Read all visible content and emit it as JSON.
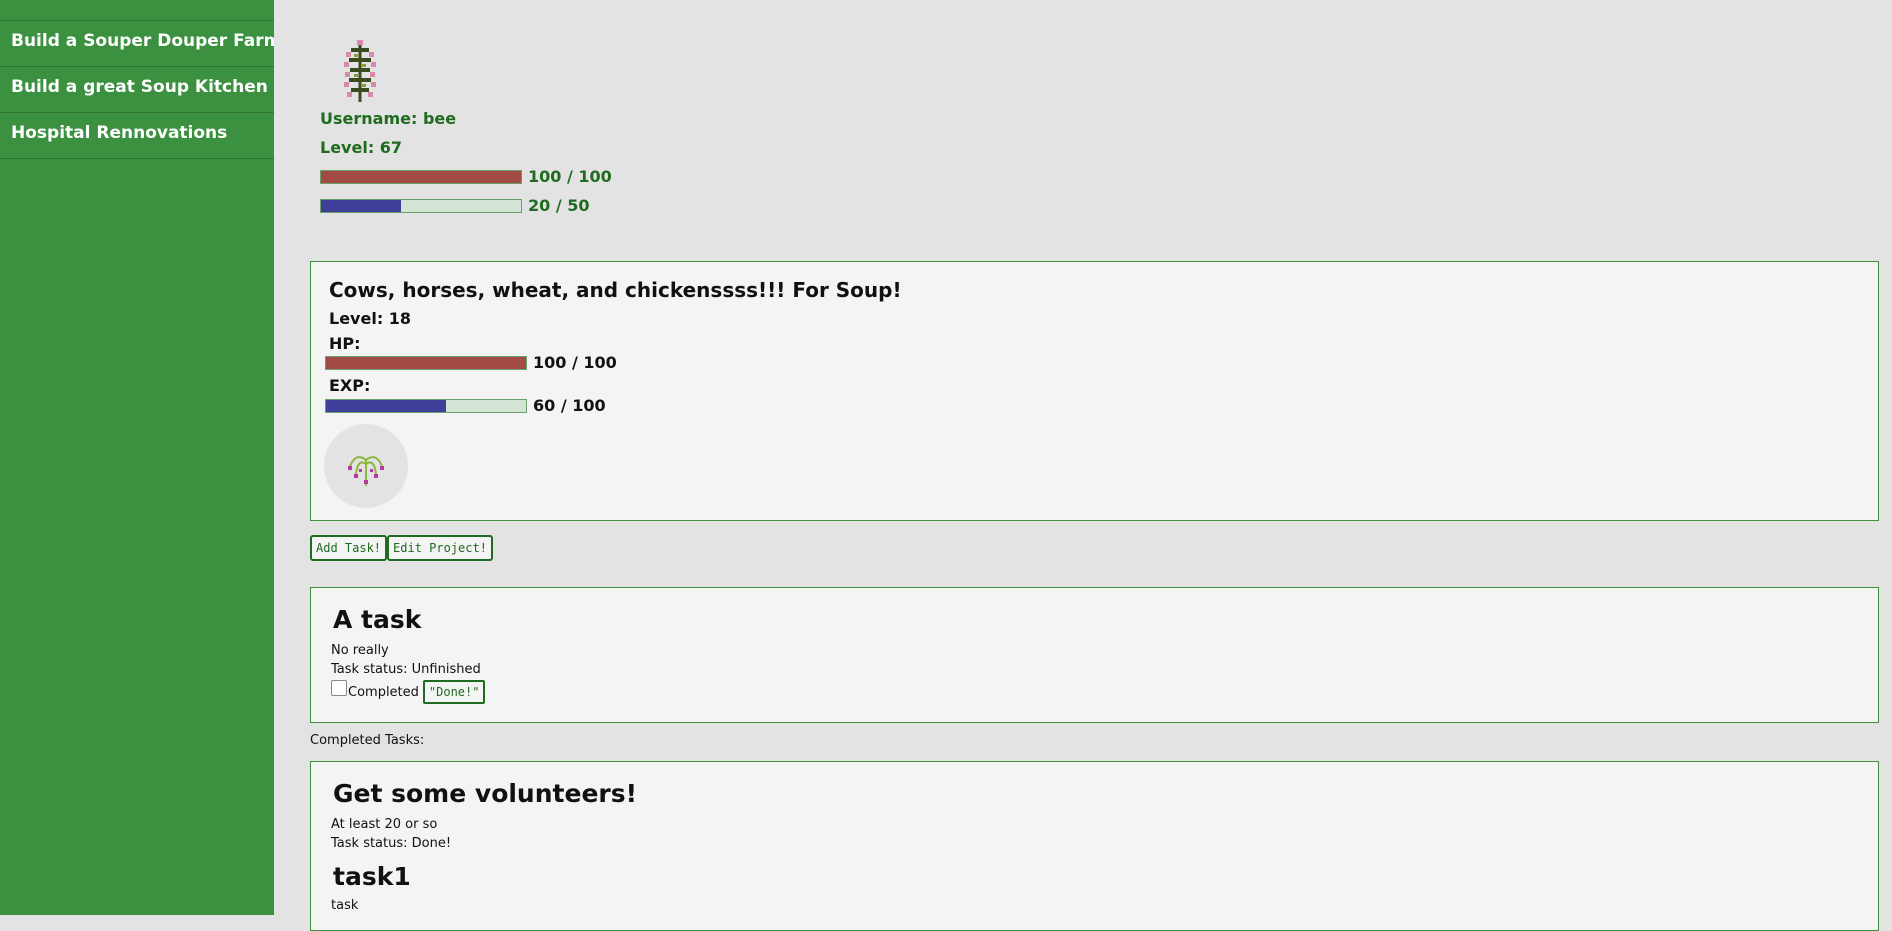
{
  "sidebar": {
    "items": [
      {
        "label": "Build a Souper Douper Farmss"
      },
      {
        "label": "Build a great Soup Kitchen"
      },
      {
        "label": "Hospital Rennovations"
      }
    ]
  },
  "profile": {
    "username": "Username: bee",
    "level": "Level: 67",
    "hp": {
      "text": "100 / 100",
      "current": 100,
      "max": 100
    },
    "exp": {
      "text": "20 / 50",
      "current": 20,
      "max": 50
    }
  },
  "project": {
    "title": "Cows, horses, wheat, and chickenssss!!! For Soup!",
    "level": "Level: 18",
    "hp_label": "HP:",
    "hp": {
      "text": "100 / 100",
      "current": 100,
      "max": 100
    },
    "exp_label": "EXP:",
    "exp": {
      "text": "60 / 100",
      "current": 60,
      "max": 100
    }
  },
  "buttons": {
    "add_task": "Add Task!",
    "edit_project": "Edit Project!"
  },
  "tasks": [
    {
      "title": "A task",
      "description": "No really",
      "status": "Task status: Unfinished",
      "completed_label": "Completed",
      "completed": false,
      "done_button": "\"Done!\""
    }
  ],
  "completed_heading": "Completed Tasks:",
  "completed_tasks": [
    {
      "title": "Get some volunteers!",
      "description": "At least 20 or so",
      "status": "Task status: Done!",
      "subtask": {
        "title": "task1",
        "description": "task"
      }
    }
  ],
  "colors": {
    "sidebar": "#3c9140",
    "accent_text": "#1f6b1f",
    "hp_fill": "#a24a44",
    "exp_fill": "#3f3f9a"
  },
  "icons": {
    "profile_avatar": "flowering-plant-icon",
    "project_avatar": "weeping-plant-icon"
  }
}
